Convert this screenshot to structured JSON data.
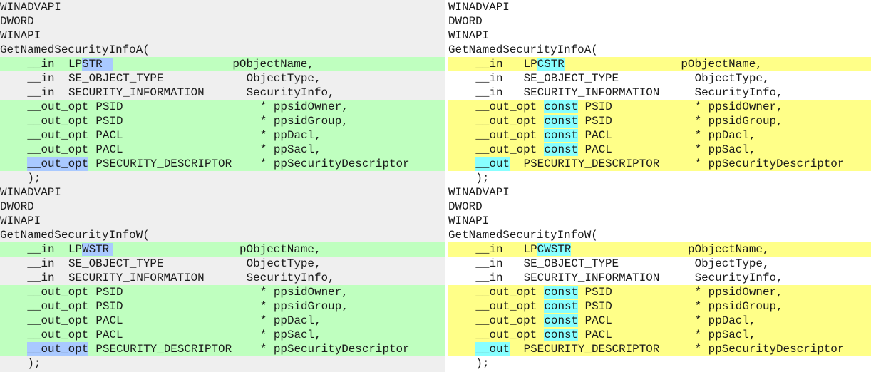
{
  "left": {
    "blocks": [
      {
        "header": [
          "WINADVAPI",
          "DWORD",
          "WINAPI",
          "GetNamedSecurityInfoA("
        ],
        "params": [
          {
            "annot": "__in",
            "type_prefix": "LP",
            "type_hl": "STR",
            "type_rest": "",
            "name": "pObjectName,",
            "changed": true
          },
          {
            "annot": "__in",
            "type_prefix": "SE_OBJECT_TYPE",
            "type_hl": "",
            "type_rest": "",
            "name": "ObjectType,",
            "changed": false
          },
          {
            "annot": "__in",
            "type_prefix": "SECURITY_INFORMATION",
            "type_hl": "",
            "type_rest": "",
            "name": "SecurityInfo,",
            "changed": false
          },
          {
            "annot": "__out_opt",
            "type_prefix": "PSID",
            "type_hl": "",
            "type_rest": "",
            "name": "* ppsidOwner,",
            "changed": true
          },
          {
            "annot": "__out_opt",
            "type_prefix": "PSID",
            "type_hl": "",
            "type_rest": "",
            "name": "* ppsidGroup,",
            "changed": true
          },
          {
            "annot": "__out_opt",
            "type_prefix": "PACL",
            "type_hl": "",
            "type_rest": "",
            "name": "* ppDacl,",
            "changed": true
          },
          {
            "annot": "__out_opt",
            "type_prefix": "PACL",
            "type_hl": "",
            "type_rest": "",
            "name": "* ppSacl,",
            "changed": true
          },
          {
            "annot": "__out_opt",
            "annot_hl": true,
            "type_prefix": "PSECURITY_DESCRIPTOR",
            "type_hl": "",
            "type_rest": "",
            "name": "* ppSecurityDescriptor",
            "changed": true
          }
        ],
        "close": ");"
      },
      {
        "header": [
          "WINADVAPI",
          "DWORD",
          "WINAPI",
          "GetNamedSecurityInfoW("
        ],
        "params": [
          {
            "annot": "__in",
            "type_prefix": "LP",
            "type_hl": "WSTR",
            "type_rest": "",
            "name": "pObjectName,",
            "changed": true
          },
          {
            "annot": "__in",
            "type_prefix": "SE_OBJECT_TYPE",
            "type_hl": "",
            "type_rest": "",
            "name": "ObjectType,",
            "changed": false
          },
          {
            "annot": "__in",
            "type_prefix": "SECURITY_INFORMATION",
            "type_hl": "",
            "type_rest": "",
            "name": "SecurityInfo,",
            "changed": false
          },
          {
            "annot": "__out_opt",
            "type_prefix": "PSID",
            "type_hl": "",
            "type_rest": "",
            "name": "* ppsidOwner,",
            "changed": true
          },
          {
            "annot": "__out_opt",
            "type_prefix": "PSID",
            "type_hl": "",
            "type_rest": "",
            "name": "* ppsidGroup,",
            "changed": true
          },
          {
            "annot": "__out_opt",
            "type_prefix": "PACL",
            "type_hl": "",
            "type_rest": "",
            "name": "* ppDacl,",
            "changed": true
          },
          {
            "annot": "__out_opt",
            "type_prefix": "PACL",
            "type_hl": "",
            "type_rest": "",
            "name": "* ppSacl,",
            "changed": true
          },
          {
            "annot": "__out_opt",
            "annot_hl": true,
            "type_prefix": "PSECURITY_DESCRIPTOR",
            "type_hl": "",
            "type_rest": "",
            "name": "* ppSecurityDescriptor",
            "changed": true
          }
        ],
        "close": ");"
      }
    ]
  },
  "right": {
    "blocks": [
      {
        "header": [
          "WINADVAPI",
          "DWORD",
          "WINAPI",
          "GetNamedSecurityInfoA("
        ],
        "params": [
          {
            "annot": "__in",
            "type_prefix": "LP",
            "type_hl": "CSTR",
            "type_rest": "",
            "name": "pObjectName,",
            "changed": true
          },
          {
            "annot": "__in",
            "type_prefix": "SE_OBJECT_TYPE",
            "type_hl": "",
            "type_rest": "",
            "name": "ObjectType,",
            "changed": false
          },
          {
            "annot": "__in",
            "type_prefix": "SECURITY_INFORMATION",
            "type_hl": "",
            "type_rest": "",
            "name": "SecurityInfo,",
            "changed": false
          },
          {
            "annot": "__out_opt",
            "type_prefix": "",
            "type_hl": "const",
            "type_rest": "PSID",
            "name": "* ppsidOwner,",
            "changed": true
          },
          {
            "annot": "__out_opt",
            "type_prefix": "",
            "type_hl": "const",
            "type_rest": "PSID",
            "name": "* ppsidGroup,",
            "changed": true
          },
          {
            "annot": "__out_opt",
            "type_prefix": "",
            "type_hl": "const",
            "type_rest": "PACL",
            "name": "* ppDacl,",
            "changed": true
          },
          {
            "annot": "__out_opt",
            "type_prefix": "",
            "type_hl": "const",
            "type_rest": "PACL",
            "name": "* ppSacl,",
            "changed": true
          },
          {
            "annot": "__out",
            "annot_hl": true,
            "type_prefix": "PSECURITY_DESCRIPTOR",
            "type_hl": "",
            "type_rest": "",
            "name": "* ppSecurityDescriptor",
            "changed": true
          }
        ],
        "close": ");"
      },
      {
        "header": [
          "WINADVAPI",
          "DWORD",
          "WINAPI",
          "GetNamedSecurityInfoW("
        ],
        "params": [
          {
            "annot": "__in",
            "type_prefix": "LP",
            "type_hl": "CWSTR",
            "type_rest": "",
            "name": "pObjectName,",
            "changed": true
          },
          {
            "annot": "__in",
            "type_prefix": "SE_OBJECT_TYPE",
            "type_hl": "",
            "type_rest": "",
            "name": "ObjectType,",
            "changed": false
          },
          {
            "annot": "__in",
            "type_prefix": "SECURITY_INFORMATION",
            "type_hl": "",
            "type_rest": "",
            "name": "SecurityInfo,",
            "changed": false
          },
          {
            "annot": "__out_opt",
            "type_prefix": "",
            "type_hl": "const",
            "type_rest": "PSID",
            "name": "* ppsidOwner,",
            "changed": true
          },
          {
            "annot": "__out_opt",
            "type_prefix": "",
            "type_hl": "const",
            "type_rest": "PSID",
            "name": "* ppsidGroup,",
            "changed": true
          },
          {
            "annot": "__out_opt",
            "type_prefix": "",
            "type_hl": "const",
            "type_rest": "PACL",
            "name": "* ppDacl,",
            "changed": true
          },
          {
            "annot": "__out_opt",
            "type_prefix": "",
            "type_hl": "const",
            "type_rest": "PACL",
            "name": "* ppSacl,",
            "changed": true
          },
          {
            "annot": "__out",
            "annot_hl": true,
            "type_prefix": "PSECURITY_DESCRIPTOR",
            "type_hl": "",
            "type_rest": "",
            "name": "* ppSecurityDescriptor",
            "changed": true
          }
        ],
        "close": ");"
      }
    ]
  },
  "colors": {
    "left_bg": "#efefef",
    "right_bg": "#ffffff",
    "left_changed": "#bfffbf",
    "right_changed": "#ffff88",
    "left_inline_hl": "#a9c9ff",
    "right_inline_hl": "#88ffff"
  }
}
